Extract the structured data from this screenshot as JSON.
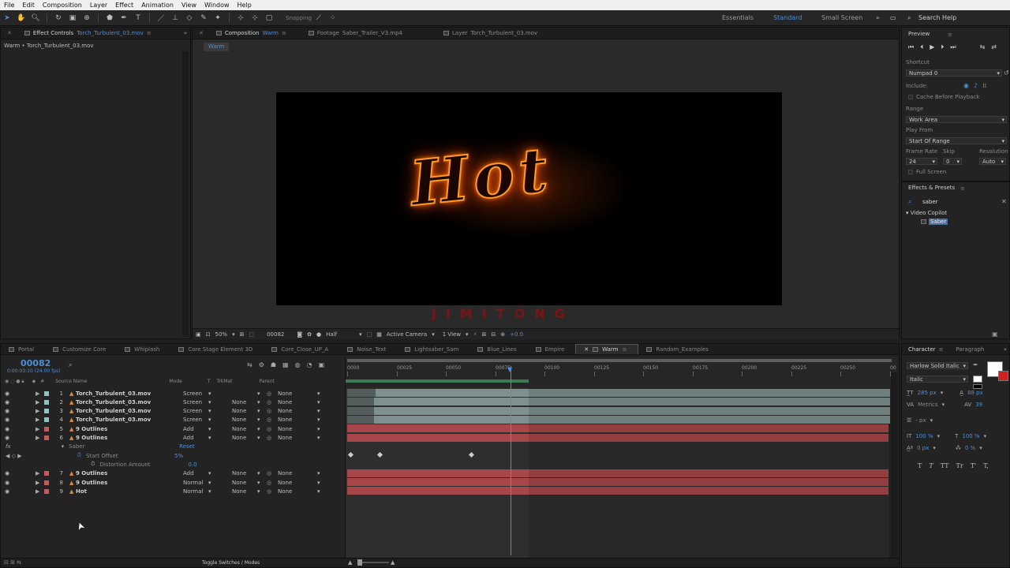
{
  "menubar": [
    "File",
    "Edit",
    "Composition",
    "Layer",
    "Effect",
    "Animation",
    "View",
    "Window",
    "Help"
  ],
  "toolbar": {
    "snapping": "Snapping",
    "workspaces": [
      "Essentials",
      "Standard",
      "Small Screen"
    ],
    "search_help": "Search Help"
  },
  "effect_controls": {
    "tab_label": "Effect Controls",
    "tab_file": "Torch_Turbulent_03.mov",
    "breadcrumb": "Warm • Torch_Turbulent_03.mov"
  },
  "viewer": {
    "tabs": [
      {
        "label": "Composition",
        "name": "Warm"
      },
      {
        "label": "Footage",
        "name": "Saber_Trailer_V3.mp4"
      },
      {
        "label": "Layer",
        "name": "Torch_Turbulent_03.mov"
      }
    ],
    "comp_chip": "Warm",
    "canvas_text": "Hot",
    "watermark": "JIMITONG",
    "zoom": "50%",
    "frame": "00082",
    "resolution": "Half",
    "camera": "Active Camera",
    "views": "1 View",
    "exposure": "+0.0"
  },
  "preview": {
    "title": "Preview",
    "shortcut_label": "Shortcut",
    "shortcut_value": "Numpad 0",
    "include_label": "Include:",
    "cache_label": "Cache Before Playback",
    "range_label": "Range",
    "range_value": "Work Area",
    "play_from_label": "Play From",
    "play_from_value": "Start Of Range",
    "frame_rate_label": "Frame Rate",
    "skip_label": "Skip",
    "resolution_label": "Resolution",
    "frame_rate_value": "24",
    "skip_value": "0",
    "resolution_value": "Auto",
    "fullscreen_label": "Full Screen"
  },
  "effects_presets": {
    "title": "Effects & Presets",
    "search_value": "saber",
    "category": "Video Copilot",
    "item": "Saber"
  },
  "timeline": {
    "tabs": [
      "Portal",
      "Customize Core",
      "Whiplash",
      "Core Stage Element 3D",
      "Core_Close_UP_A",
      "Noise_Text",
      "Lightsaber_Sam",
      "Blue_Lines",
      "Empire",
      "Warm",
      "Random_Examples"
    ],
    "active_tab": "Warm",
    "timecode": "00082",
    "timecode_sub": "0:00:03:10 (24.00 fps)",
    "col_source": "Source Name",
    "col_mode": "Mode",
    "col_t": "T",
    "col_trkmat": "TrkMat",
    "col_parent": "Parent",
    "ruler": [
      "0000",
      "00025",
      "00050",
      "00075",
      "00100",
      "00125",
      "00150",
      "00175",
      "00200",
      "00225",
      "00250",
      "00"
    ],
    "layers": [
      {
        "num": "1",
        "name": "Torch_Turbulent_03.mov",
        "mode": "Screen",
        "trkmat": "",
        "parent": "None",
        "color": "#8fc2c0"
      },
      {
        "num": "2",
        "name": "Torch_Turbulent_03.mov",
        "mode": "Screen",
        "trkmat": "None",
        "parent": "None",
        "color": "#8fc2c0"
      },
      {
        "num": "3",
        "name": "Torch_Turbulent_03.mov",
        "mode": "Screen",
        "trkmat": "None",
        "parent": "None",
        "color": "#8fc2c0"
      },
      {
        "num": "4",
        "name": "Torch_Turbulent_03.mov",
        "mode": "Screen",
        "trkmat": "None",
        "parent": "None",
        "color": "#8fc2c0"
      },
      {
        "num": "5",
        "name": "9 Outlines",
        "mode": "Add",
        "trkmat": "None",
        "parent": "None",
        "color": "#c45a5a"
      },
      {
        "num": "6",
        "name": "9 Outlines",
        "mode": "Add",
        "trkmat": "None",
        "parent": "None",
        "color": "#c45a5a"
      }
    ],
    "effect_name": "Saber",
    "effect_reset": "Reset",
    "props": [
      {
        "name": "Start Offset",
        "value": "5%"
      },
      {
        "name": "Distortion Amount",
        "value": "0.0"
      }
    ],
    "layers_b": [
      {
        "num": "7",
        "name": "9 Outlines",
        "mode": "Add",
        "trkmat": "None",
        "parent": "None",
        "color": "#c45a5a"
      },
      {
        "num": "8",
        "name": "9 Outlines",
        "mode": "Normal",
        "trkmat": "None",
        "parent": "None",
        "color": "#c45a5a"
      },
      {
        "num": "9",
        "name": "Hot",
        "mode": "Normal",
        "trkmat": "None",
        "parent": "None",
        "color": "#c45a5a"
      }
    ],
    "toggle_label": "Toggle Switches / Modes"
  },
  "character": {
    "title": "Character",
    "tab2": "Paragraph",
    "font": "Harlow Solid Italic",
    "style": "Italic",
    "size": "285 px",
    "leading": "88 px",
    "kerning": "Metrics",
    "tracking": "39",
    "stroke": "- px",
    "vscale": "100 %",
    "hscale": "100 %",
    "baseline": "0 px",
    "tsume": "0 %",
    "styles": [
      "T",
      "T",
      "TT",
      "Tr",
      "T'",
      "T,"
    ]
  }
}
